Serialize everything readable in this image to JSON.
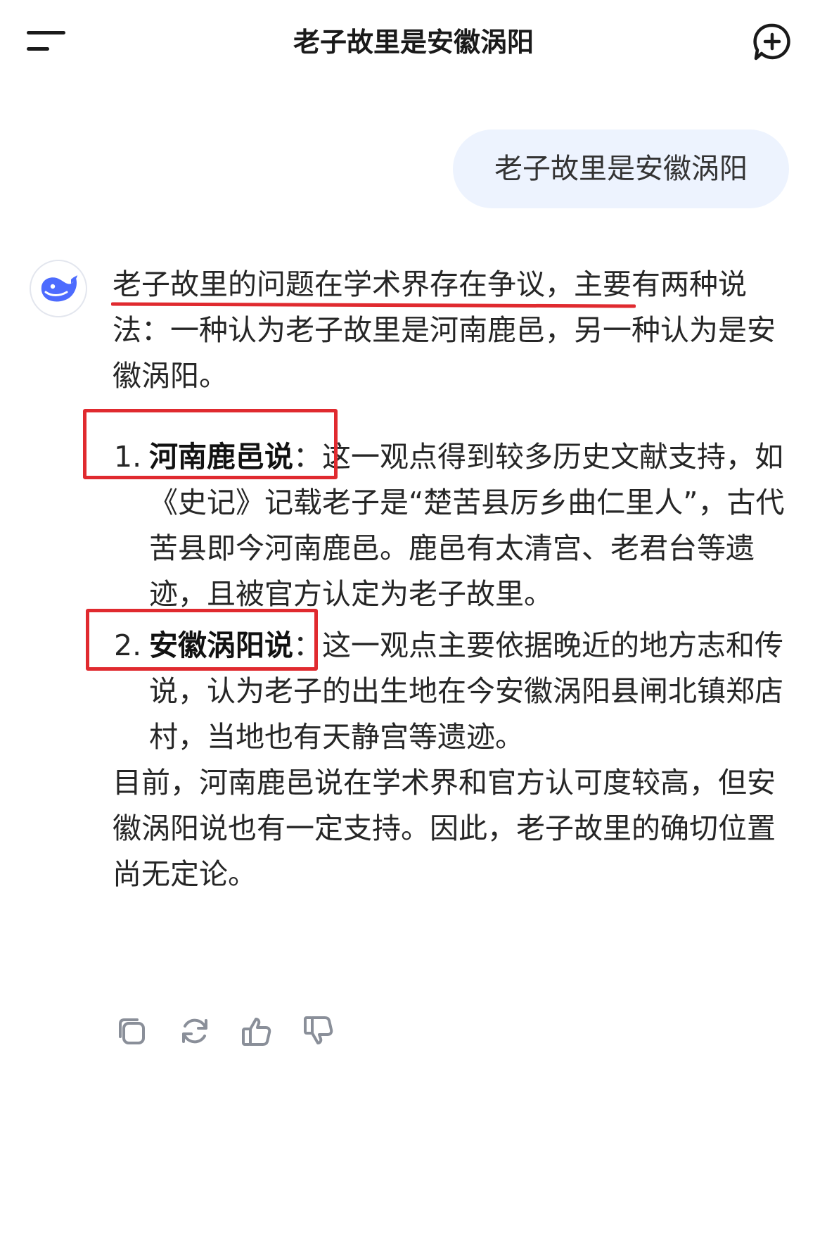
{
  "header": {
    "title": "老子故里是安徽涡阳"
  },
  "conversation": {
    "user_message": "老子故里是安徽涡阳",
    "assistant": {
      "intro": "老子故里的问题在学术界存在争议，主要有两种说法：一种认为老子故里是河南鹿邑，另一种认为是安徽涡阳。",
      "points": [
        {
          "number": "1.",
          "head": "河南鹿邑说",
          "body": "：这一观点得到较多历史文献支持，如《史记》记载老子是“楚苦县厉乡曲仁里人”，古代苦县即今河南鹿邑。鹿邑有太清宫、老君台等遗迹，且被官方认定为老子故里。"
        },
        {
          "number": "2.",
          "head": "安徽涡阳说",
          "body": "：这一观点主要依据晚近的地方志和传说，认为老子的出生地在今安徽涡阳县闸北镇郑店村，当地也有天静宫等遗迹。"
        }
      ],
      "conclusion": "目前，河南鹿邑说在学术界和官方认可度较高，但安徽涡阳说也有一定支持。因此，老子故里的确切位置尚无定论。"
    }
  },
  "actions": {
    "icons": [
      "copy-icon",
      "regenerate-icon",
      "thumbs-up-icon",
      "thumbs-down-icon"
    ]
  },
  "colors": {
    "accent": "#4d6bfe",
    "user_bubble": "#edf3fe",
    "annotation_red": "#e02a2f",
    "icon_gray": "#8a8f99"
  }
}
